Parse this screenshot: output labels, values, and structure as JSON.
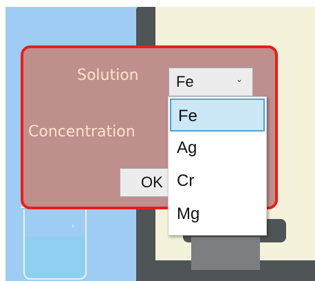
{
  "dialog": {
    "solution_label": "Solution",
    "concentration_label": "Concentration",
    "solution_select": {
      "selected": "Fe",
      "arrow_icon": "chevron-down-icon"
    },
    "ok_label": "OK"
  },
  "dropdown": {
    "options": [
      "Fe",
      "Ag",
      "Cr",
      "Mg"
    ],
    "highlighted": "Fe"
  },
  "colors": {
    "dialog_bg": "#bf8f8d",
    "dialog_border": "#ee1b1b",
    "label_text": "#fbe3c8",
    "left_bg": "#9fccf3",
    "instrument_frame": "#4f5456",
    "instrument_screen": "#f4f2da",
    "highlight_bg": "#cce8f6",
    "highlight_border": "#4aa3df"
  }
}
